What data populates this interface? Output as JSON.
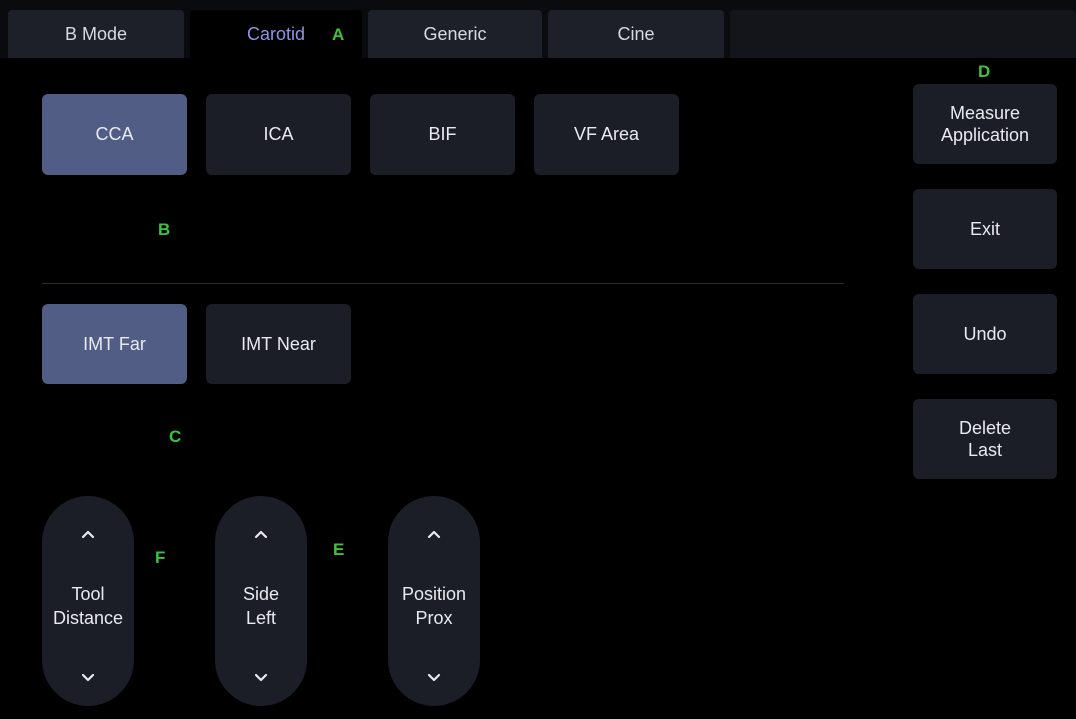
{
  "tabs": [
    {
      "label": "B Mode"
    },
    {
      "label": "Carotid"
    },
    {
      "label": "Generic"
    },
    {
      "label": "Cine"
    }
  ],
  "vessel_buttons": [
    {
      "label": "CCA",
      "selected": true
    },
    {
      "label": "ICA",
      "selected": false
    },
    {
      "label": "BIF",
      "selected": false
    },
    {
      "label": "VF Area",
      "selected": false
    }
  ],
  "imt_buttons": [
    {
      "label": "IMT Far",
      "selected": true
    },
    {
      "label": "IMT Near",
      "selected": false
    }
  ],
  "side_buttons": {
    "measure_application": "Measure\nApplication",
    "exit": "Exit",
    "undo": "Undo",
    "delete_last": "Delete\nLast"
  },
  "steppers": [
    {
      "line1": "Tool",
      "line2": "Distance"
    },
    {
      "line1": "Side",
      "line2": "Left"
    },
    {
      "line1": "Position",
      "line2": "Prox"
    }
  ],
  "markers": {
    "a": "A",
    "b": "B",
    "c": "C",
    "d": "D",
    "e": "E",
    "f": "F"
  },
  "colors": {
    "background": "#000000",
    "button": "#1c1e27",
    "selected_button": "#525d86",
    "active_tab_text": "#8f93e8",
    "marker": "#3cc23c"
  }
}
